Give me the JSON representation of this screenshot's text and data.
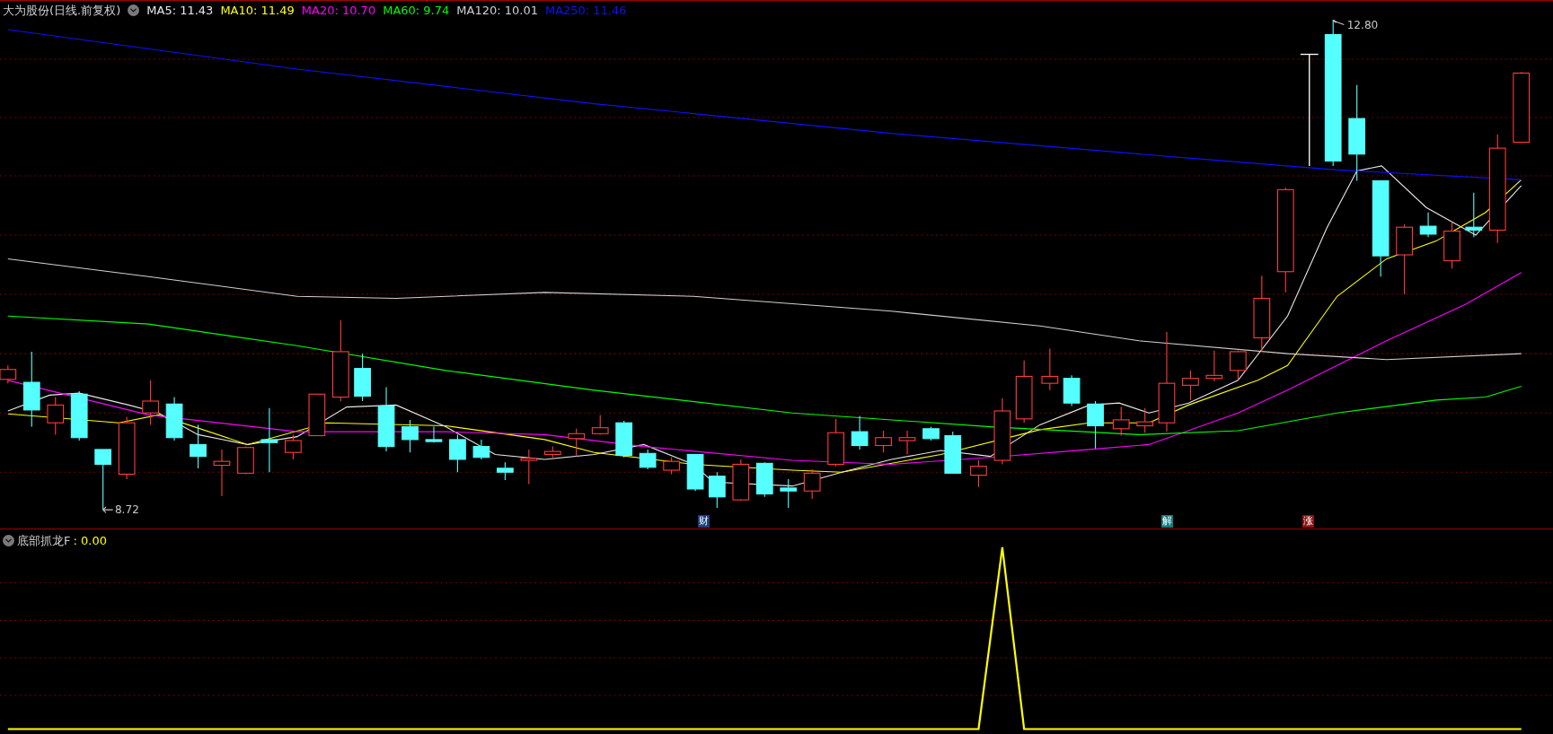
{
  "header": {
    "title": "大为股份(日线.前复权)",
    "indicators": [
      {
        "label": "MA5: 11.43",
        "color": "#e8e8e8"
      },
      {
        "label": "MA10: 11.49",
        "color": "#ffff00"
      },
      {
        "label": "MA20: 10.70",
        "color": "#ff00ff"
      },
      {
        "label": "MA60: 9.74",
        "color": "#00ff00"
      },
      {
        "label": "MA120: 10.01",
        "color": "#d0d0d0"
      },
      {
        "label": "MA250: 11.46",
        "color": "#1010ff"
      }
    ]
  },
  "price_chart": {
    "high_label": "12.80",
    "low_label": "8.72",
    "event_markers": [
      {
        "label": "财",
        "color": "#1c3f78"
      },
      {
        "label": "解",
        "color": "#0e7d7d"
      },
      {
        "label": "涨",
        "color": "#8a1212"
      }
    ]
  },
  "indicator_panel": {
    "title": "底部抓龙F",
    "value": ": 0.00"
  }
}
